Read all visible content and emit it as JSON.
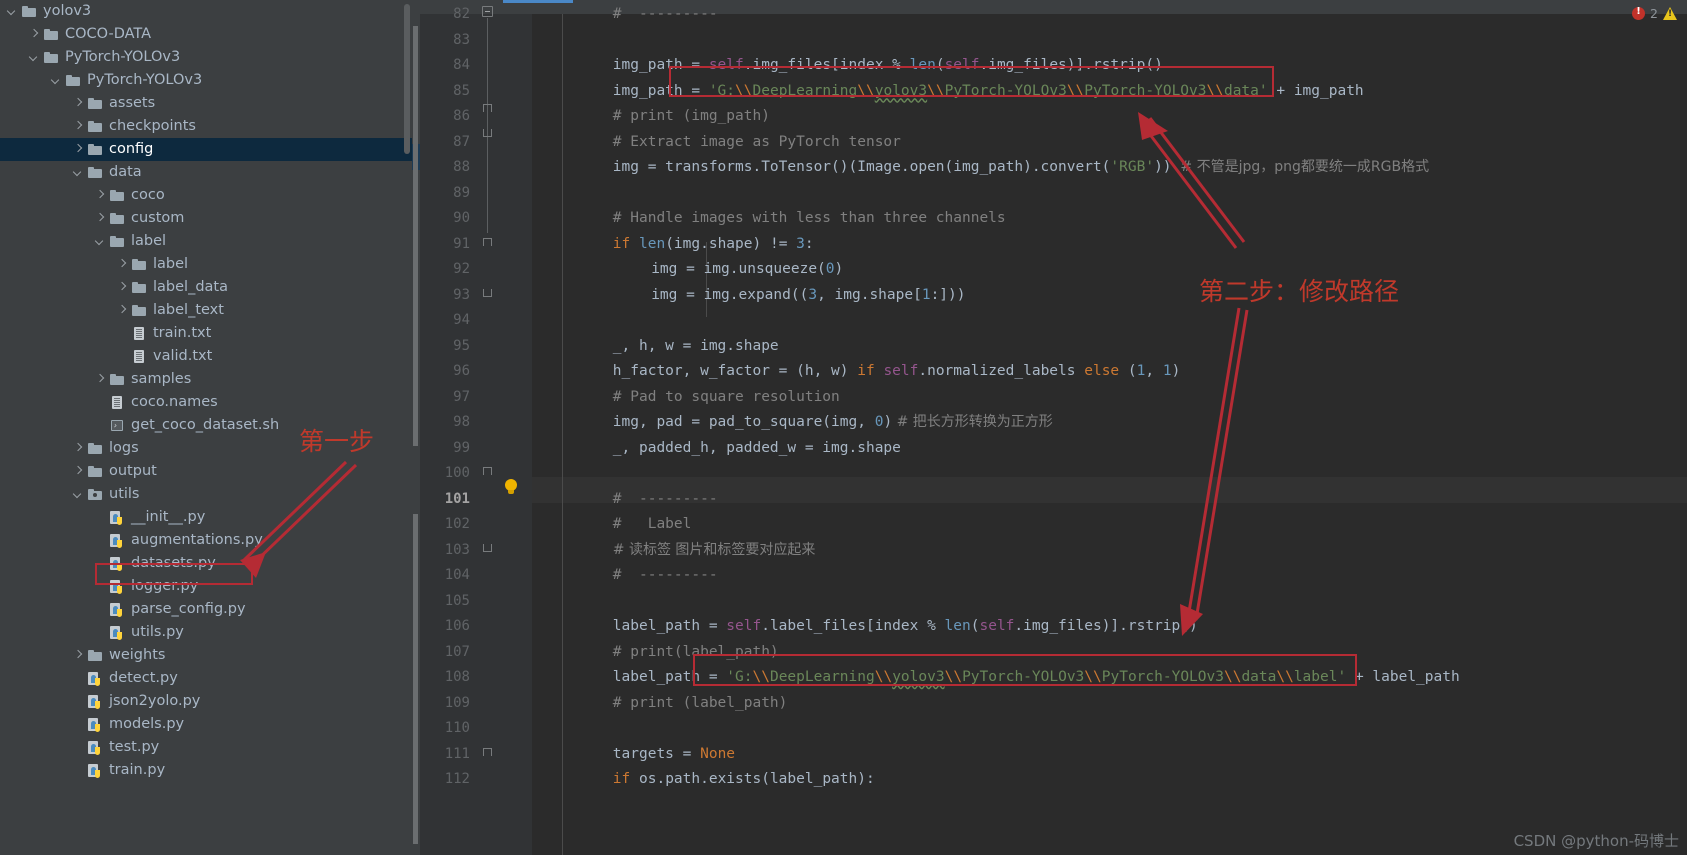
{
  "project_tree": [
    {
      "label": "yolov3",
      "depth": 0,
      "arrow": "expanded",
      "icon": "folder",
      "selected": false
    },
    {
      "label": "COCO-DATA",
      "depth": 1,
      "arrow": "collapsed",
      "icon": "folder",
      "selected": false
    },
    {
      "label": "PyTorch-YOLOv3",
      "depth": 1,
      "arrow": "expanded",
      "icon": "folder",
      "selected": false
    },
    {
      "label": "PyTorch-YOLOv3",
      "depth": 2,
      "arrow": "expanded",
      "icon": "folder",
      "selected": false
    },
    {
      "label": "assets",
      "depth": 3,
      "arrow": "collapsed",
      "icon": "folder",
      "selected": false
    },
    {
      "label": "checkpoints",
      "depth": 3,
      "arrow": "collapsed",
      "icon": "folder",
      "selected": false
    },
    {
      "label": "config",
      "depth": 3,
      "arrow": "collapsed",
      "icon": "folder",
      "selected": true
    },
    {
      "label": "data",
      "depth": 3,
      "arrow": "expanded",
      "icon": "folder",
      "selected": false
    },
    {
      "label": "coco",
      "depth": 4,
      "arrow": "collapsed",
      "icon": "folder",
      "selected": false
    },
    {
      "label": "custom",
      "depth": 4,
      "arrow": "collapsed",
      "icon": "folder",
      "selected": false
    },
    {
      "label": "label",
      "depth": 4,
      "arrow": "expanded",
      "icon": "folder",
      "selected": false
    },
    {
      "label": "label",
      "depth": 5,
      "arrow": "collapsed",
      "icon": "folder",
      "selected": false
    },
    {
      "label": "label_data",
      "depth": 5,
      "arrow": "collapsed",
      "icon": "folder",
      "selected": false
    },
    {
      "label": "label_text",
      "depth": 5,
      "arrow": "collapsed",
      "icon": "folder",
      "selected": false
    },
    {
      "label": "train.txt",
      "depth": 5,
      "arrow": "none",
      "icon": "txt",
      "selected": false
    },
    {
      "label": "valid.txt",
      "depth": 5,
      "arrow": "none",
      "icon": "txt",
      "selected": false
    },
    {
      "label": "samples",
      "depth": 4,
      "arrow": "collapsed",
      "icon": "folder",
      "selected": false
    },
    {
      "label": "coco.names",
      "depth": 4,
      "arrow": "none",
      "icon": "txt",
      "selected": false
    },
    {
      "label": "get_coco_dataset.sh",
      "depth": 4,
      "arrow": "none",
      "icon": "sh",
      "selected": false
    },
    {
      "label": "logs",
      "depth": 3,
      "arrow": "collapsed",
      "icon": "folder",
      "selected": false
    },
    {
      "label": "output",
      "depth": 3,
      "arrow": "collapsed",
      "icon": "folder",
      "selected": false
    },
    {
      "label": "utils",
      "depth": 3,
      "arrow": "expanded",
      "icon": "modfolder",
      "selected": false
    },
    {
      "label": "__init__.py",
      "depth": 4,
      "arrow": "none",
      "icon": "py",
      "selected": false
    },
    {
      "label": "augmentations.py",
      "depth": 4,
      "arrow": "none",
      "icon": "py",
      "selected": false
    },
    {
      "label": "datasets.py",
      "depth": 4,
      "arrow": "none",
      "icon": "py",
      "selected": false
    },
    {
      "label": "logger.py",
      "depth": 4,
      "arrow": "none",
      "icon": "py",
      "selected": false
    },
    {
      "label": "parse_config.py",
      "depth": 4,
      "arrow": "none",
      "icon": "py",
      "selected": false
    },
    {
      "label": "utils.py",
      "depth": 4,
      "arrow": "none",
      "icon": "py",
      "selected": false
    },
    {
      "label": "weights",
      "depth": 3,
      "arrow": "collapsed",
      "icon": "folder",
      "selected": false
    },
    {
      "label": "detect.py",
      "depth": 3,
      "arrow": "none",
      "icon": "py",
      "selected": false
    },
    {
      "label": "json2yolo.py",
      "depth": 3,
      "arrow": "none",
      "icon": "py",
      "selected": false
    },
    {
      "label": "models.py",
      "depth": 3,
      "arrow": "none",
      "icon": "py",
      "selected": false
    },
    {
      "label": "test.py",
      "depth": 3,
      "arrow": "none",
      "icon": "py",
      "selected": false
    },
    {
      "label": "train.py",
      "depth": 3,
      "arrow": "none",
      "icon": "py",
      "selected": false
    }
  ],
  "editor": {
    "first_line_number": 82,
    "current_line_number": 101,
    "error_count": "2",
    "error_icon": "error-circle-icon",
    "warning_icon": "warning-triangle-icon",
    "lines": [
      {
        "n": 82,
        "indent": 2,
        "tokens": [
          {
            "t": "#  ---------",
            "c": "cm"
          }
        ]
      },
      {
        "n": 83,
        "indent": 0,
        "tokens": []
      },
      {
        "n": 84,
        "indent": 2,
        "tokens": [
          {
            "t": "img_path = ",
            "c": "id"
          },
          {
            "t": "self",
            "c": "selfk"
          },
          {
            "t": ".img_files[index % ",
            "c": "id"
          },
          {
            "t": "len",
            "c": "num"
          },
          {
            "t": "(",
            "c": "id"
          },
          {
            "t": "self",
            "c": "selfk"
          },
          {
            "t": ".img_files)].rstrip()",
            "c": "id"
          }
        ]
      },
      {
        "n": 85,
        "indent": 2,
        "tokens": [
          {
            "t": "img_path = ",
            "c": "id"
          },
          {
            "t": "'G:",
            "c": "str"
          },
          {
            "t": "\\\\",
            "c": "esc"
          },
          {
            "t": "DeepLearning",
            "c": "str"
          },
          {
            "t": "\\\\",
            "c": "esc"
          },
          {
            "t": "yolov3",
            "c": "str wavy"
          },
          {
            "t": "\\\\",
            "c": "esc"
          },
          {
            "t": "PyTorch-YOLOv3",
            "c": "str"
          },
          {
            "t": "\\\\",
            "c": "esc"
          },
          {
            "t": "PyTorch-YOLOv3",
            "c": "str"
          },
          {
            "t": "\\\\",
            "c": "esc"
          },
          {
            "t": "data'",
            "c": "str"
          },
          {
            "t": " + img_path",
            "c": "id"
          }
        ]
      },
      {
        "n": 86,
        "indent": 2,
        "tokens": [
          {
            "t": "# print (img_path)",
            "c": "cm"
          }
        ]
      },
      {
        "n": 87,
        "indent": 2,
        "tokens": [
          {
            "t": "# Extract image as PyTorch tensor",
            "c": "cm"
          }
        ]
      },
      {
        "n": 88,
        "indent": 2,
        "tokens": [
          {
            "t": "img = transforms.ToTensor()(Image.open(img_path).convert(",
            "c": "id"
          },
          {
            "t": "'RGB'",
            "c": "str"
          },
          {
            "t": "))",
            "c": "id"
          },
          {
            "t": "  # 不管是jpg，png都要统一成RGB格式",
            "c": "cmz"
          }
        ]
      },
      {
        "n": 89,
        "indent": 0,
        "tokens": []
      },
      {
        "n": 90,
        "indent": 2,
        "tokens": [
          {
            "t": "# Handle images with less than three channels",
            "c": "cm"
          }
        ]
      },
      {
        "n": 91,
        "indent": 2,
        "tokens": [
          {
            "t": "if ",
            "c": "kw"
          },
          {
            "t": "len",
            "c": "num"
          },
          {
            "t": "(img.shape) != ",
            "c": "id"
          },
          {
            "t": "3",
            "c": "num"
          },
          {
            "t": ":",
            "c": "id"
          }
        ]
      },
      {
        "n": 92,
        "indent": 3,
        "tokens": [
          {
            "t": "img = img.unsqueeze(",
            "c": "id"
          },
          {
            "t": "0",
            "c": "num"
          },
          {
            "t": ")",
            "c": "id"
          }
        ]
      },
      {
        "n": 93,
        "indent": 3,
        "tokens": [
          {
            "t": "img = img.expand((",
            "c": "id"
          },
          {
            "t": "3",
            "c": "num"
          },
          {
            "t": ", img.shape[",
            "c": "id"
          },
          {
            "t": "1",
            "c": "num"
          },
          {
            "t": ":]))",
            "c": "id"
          }
        ]
      },
      {
        "n": 94,
        "indent": 0,
        "tokens": []
      },
      {
        "n": 95,
        "indent": 2,
        "tokens": [
          {
            "t": "_, h, w = img.shape",
            "c": "id"
          }
        ]
      },
      {
        "n": 96,
        "indent": 2,
        "tokens": [
          {
            "t": "h_factor, w_factor = (h, w) ",
            "c": "id"
          },
          {
            "t": "if ",
            "c": "kw"
          },
          {
            "t": "self",
            "c": "selfk"
          },
          {
            "t": ".normalized_labels ",
            "c": "id"
          },
          {
            "t": "else ",
            "c": "kw"
          },
          {
            "t": "(",
            "c": "id"
          },
          {
            "t": "1",
            "c": "num"
          },
          {
            "t": ", ",
            "c": "id"
          },
          {
            "t": "1",
            "c": "num"
          },
          {
            "t": ")",
            "c": "id"
          }
        ]
      },
      {
        "n": 97,
        "indent": 2,
        "tokens": [
          {
            "t": "# Pad to square resolution",
            "c": "cm"
          }
        ]
      },
      {
        "n": 98,
        "indent": 2,
        "tokens": [
          {
            "t": "img, pad = pad_to_square(img, ",
            "c": "id"
          },
          {
            "t": "0",
            "c": "num"
          },
          {
            "t": ")",
            "c": "id"
          },
          {
            "t": " # 把长方形转换为正方形",
            "c": "cmz"
          }
        ]
      },
      {
        "n": 99,
        "indent": 2,
        "tokens": [
          {
            "t": "_, padded_h, padded_w = img.shape",
            "c": "id"
          }
        ]
      },
      {
        "n": 100,
        "indent": 0,
        "tokens": []
      },
      {
        "n": 101,
        "indent": 2,
        "tokens": [
          {
            "t": "#  ---------",
            "c": "cm"
          }
        ]
      },
      {
        "n": 102,
        "indent": 2,
        "tokens": [
          {
            "t": "#   Label",
            "c": "cm"
          }
        ]
      },
      {
        "n": 103,
        "indent": 2,
        "tokens": [
          {
            "t": "# 读标签 图片和标签要对应起来",
            "c": "cmz"
          }
        ]
      },
      {
        "n": 104,
        "indent": 2,
        "tokens": [
          {
            "t": "#  ---------",
            "c": "cm"
          }
        ]
      },
      {
        "n": 105,
        "indent": 0,
        "tokens": []
      },
      {
        "n": 106,
        "indent": 2,
        "tokens": [
          {
            "t": "label_path = ",
            "c": "id"
          },
          {
            "t": "self",
            "c": "selfk"
          },
          {
            "t": ".label_files[index % ",
            "c": "id"
          },
          {
            "t": "len",
            "c": "num"
          },
          {
            "t": "(",
            "c": "id"
          },
          {
            "t": "self",
            "c": "selfk"
          },
          {
            "t": ".img_files)].rstrip()",
            "c": "id"
          }
        ]
      },
      {
        "n": 107,
        "indent": 2,
        "tokens": [
          {
            "t": "# print(label_path)",
            "c": "cm"
          }
        ]
      },
      {
        "n": 108,
        "indent": 2,
        "tokens": [
          {
            "t": "label_path = ",
            "c": "id"
          },
          {
            "t": "'G:",
            "c": "str"
          },
          {
            "t": "\\\\",
            "c": "esc"
          },
          {
            "t": "DeepLearning",
            "c": "str"
          },
          {
            "t": "\\\\",
            "c": "esc"
          },
          {
            "t": "yolov3",
            "c": "str wavy"
          },
          {
            "t": "\\\\",
            "c": "esc"
          },
          {
            "t": "PyTorch-YOLOv3",
            "c": "str"
          },
          {
            "t": "\\\\",
            "c": "esc"
          },
          {
            "t": "PyTorch-YOLOv3",
            "c": "str"
          },
          {
            "t": "\\\\",
            "c": "esc"
          },
          {
            "t": "data",
            "c": "str"
          },
          {
            "t": "\\\\",
            "c": "esc"
          },
          {
            "t": "label'",
            "c": "str"
          },
          {
            "t": " + label_path",
            "c": "id"
          }
        ]
      },
      {
        "n": 109,
        "indent": 2,
        "tokens": [
          {
            "t": "# print (label_path)",
            "c": "cm"
          }
        ]
      },
      {
        "n": 110,
        "indent": 0,
        "tokens": []
      },
      {
        "n": 111,
        "indent": 2,
        "tokens": [
          {
            "t": "targets = ",
            "c": "id"
          },
          {
            "t": "None",
            "c": "kw"
          }
        ]
      },
      {
        "n": 112,
        "indent": 2,
        "tokens": [
          {
            "t": "if ",
            "c": "kw"
          },
          {
            "t": "os.path.exists(label_path):",
            "c": "id"
          }
        ]
      }
    ]
  },
  "annotations": {
    "step_one": "第一步",
    "step_two": "第二步：修改路径"
  },
  "watermark": "CSDN @python-码博士"
}
